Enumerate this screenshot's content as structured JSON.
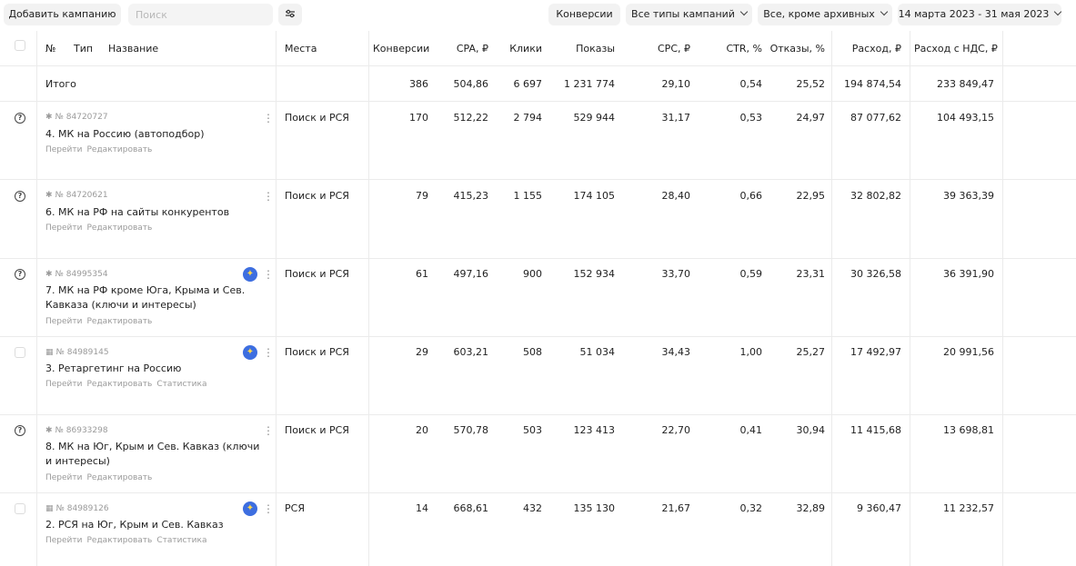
{
  "toolbar": {
    "add_campaign": "Добавить кампанию",
    "search_placeholder": "Поиск",
    "conversions": "Конверсии",
    "campaign_types": "Все типы кампаний",
    "archive_filter": "Все, кроме архивных",
    "date_range": "14 марта 2023 - 31 мая 2023"
  },
  "headers": {
    "no": "№",
    "type": "Тип",
    "name": "Название",
    "places": "Места",
    "conversions": "Конверсии ↓",
    "cpa": "CPA, ₽",
    "clicks": "Клики",
    "shows": "Показы",
    "cpc": "CPC, ₽",
    "ctr": "CTR, %",
    "bounces": "Отказы, %",
    "spend": "Расход, ₽",
    "spend_vat": "Расход с НДС, ₽"
  },
  "total": {
    "label": "Итого",
    "conversions": "386",
    "cpa": "504,86",
    "clicks": "6 697",
    "shows": "1 231 774",
    "cpc": "29,10",
    "ctr": "0,54",
    "bounces": "25,52",
    "spend": "194 874,54",
    "spend_vat": "233 849,47"
  },
  "rows": [
    {
      "id": "№ 84720727",
      "type_icon": "text-ad-icon",
      "name": "4. МК на Россию (автоподбор)",
      "links": [
        "Перейти",
        "Редактировать"
      ],
      "places": "Поиск и РСЯ",
      "conversions": "170",
      "cpa": "512,22",
      "clicks": "2 794",
      "shows": "529 944",
      "cpc": "31,17",
      "ctr": "0,53",
      "bounces": "24,97",
      "spend": "87 077,62",
      "spend_vat": "104 493,15"
    },
    {
      "id": "№ 84720621",
      "type_icon": "text-ad-icon",
      "name": "6. МК на РФ на сайты конкурентов",
      "links": [
        "Перейти",
        "Редактировать"
      ],
      "places": "Поиск и РСЯ",
      "conversions": "79",
      "cpa": "415,23",
      "clicks": "1 155",
      "shows": "174 105",
      "cpc": "28,40",
      "ctr": "0,66",
      "bounces": "22,95",
      "spend": "32 802,82",
      "spend_vat": "39 363,39"
    },
    {
      "id": "№ 84995354",
      "type_icon": "text-ad-icon",
      "name": "7. МК на РФ кроме Юга, Крыма и Сев. Кавказа (ключи и интересы)",
      "links": [
        "Перейти",
        "Редактировать"
      ],
      "places": "Поиск и РСЯ",
      "conversions": "61",
      "cpa": "497,16",
      "clicks": "900",
      "shows": "152 934",
      "cpc": "33,70",
      "ctr": "0,59",
      "bounces": "23,31",
      "spend": "30 326,58",
      "spend_vat": "36 391,90"
    },
    {
      "id": "№ 84989145",
      "type_icon": "smart-banner-icon",
      "name": "3. Ретаргетинг на Россию",
      "links": [
        "Перейти",
        "Редактировать",
        "Статистика"
      ],
      "places": "Поиск и РСЯ",
      "conversions": "29",
      "cpa": "603,21",
      "clicks": "508",
      "shows": "51 034",
      "cpc": "34,43",
      "ctr": "1,00",
      "bounces": "25,27",
      "spend": "17 492,97",
      "spend_vat": "20 991,56"
    },
    {
      "id": "№ 86933298",
      "type_icon": "text-ad-icon",
      "name": "8. МК на Юг, Крым и Сев. Кавказ (ключи и интересы)",
      "links": [
        "Перейти",
        "Редактировать"
      ],
      "places": "Поиск и РСЯ",
      "conversions": "20",
      "cpa": "570,78",
      "clicks": "503",
      "shows": "123 413",
      "cpc": "22,70",
      "ctr": "0,41",
      "bounces": "30,94",
      "spend": "11 415,68",
      "spend_vat": "13 698,81"
    },
    {
      "id": "№ 84989126",
      "type_icon": "smart-banner-icon",
      "name": "2. РСЯ на Юг, Крым и Сев. Кавказ",
      "links": [
        "Перейти",
        "Редактировать",
        "Статистика"
      ],
      "places": "РСЯ",
      "conversions": "14",
      "cpa": "668,61",
      "clicks": "432",
      "shows": "135 130",
      "cpc": "21,67",
      "ctr": "0,32",
      "bounces": "32,89",
      "spend": "9 360,47",
      "spend_vat": "11 232,57"
    }
  ]
}
